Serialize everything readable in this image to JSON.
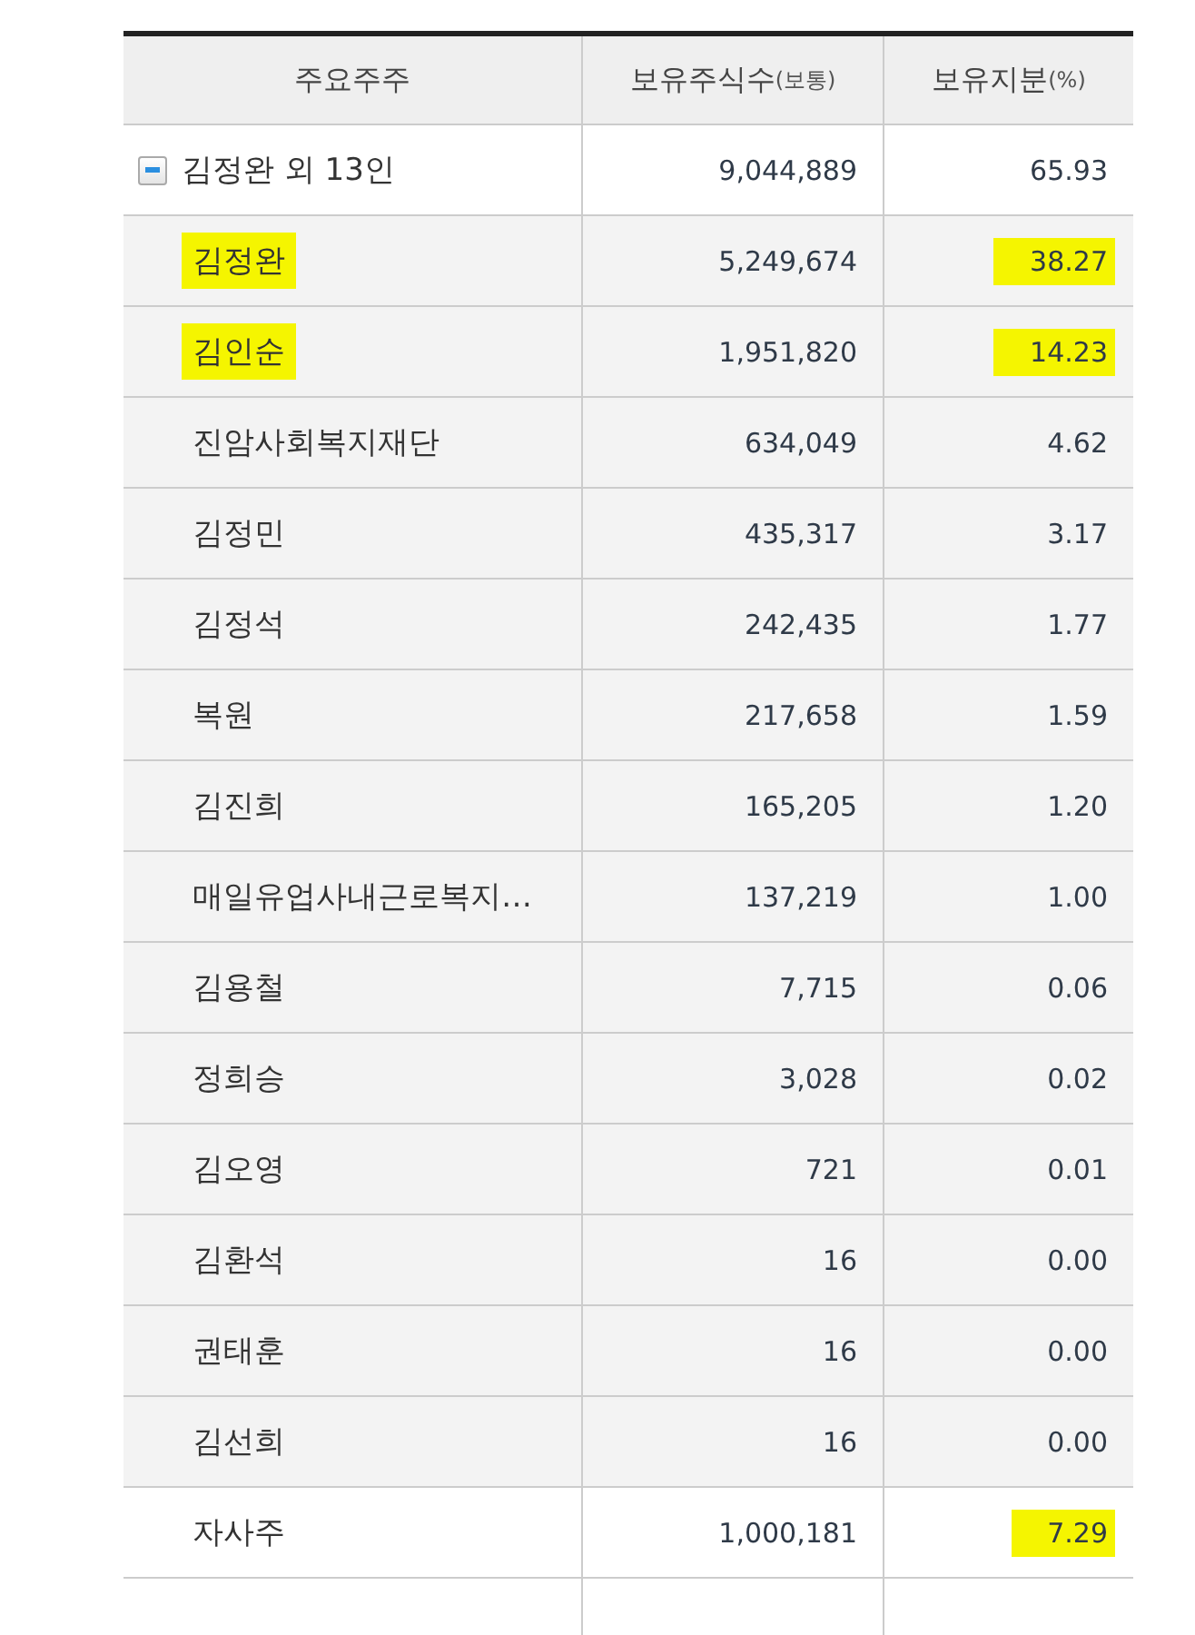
{
  "table": {
    "columns": [
      {
        "label": "주요주주"
      },
      {
        "label": "보유주식수",
        "unit": "(보통)"
      },
      {
        "label": "보유지분",
        "unit": "(%)"
      }
    ],
    "group": {
      "name": "김정완 외 13인",
      "shares": "9,044,889",
      "stake": "65.93",
      "expanded": true
    },
    "rows": [
      {
        "name": "김정완",
        "shares": "5,249,674",
        "stake": "38.27",
        "name_highlighted": true,
        "stake_highlighted": true
      },
      {
        "name": "김인순",
        "shares": "1,951,820",
        "stake": "14.23",
        "name_highlighted": true,
        "stake_highlighted": true
      },
      {
        "name": "진암사회복지재단",
        "shares": "634,049",
        "stake": "4.62",
        "name_highlighted": false,
        "stake_highlighted": false
      },
      {
        "name": "김정민",
        "shares": "435,317",
        "stake": "3.17",
        "name_highlighted": false,
        "stake_highlighted": false
      },
      {
        "name": "김정석",
        "shares": "242,435",
        "stake": "1.77",
        "name_highlighted": false,
        "stake_highlighted": false
      },
      {
        "name": "복원",
        "shares": "217,658",
        "stake": "1.59",
        "name_highlighted": false,
        "stake_highlighted": false
      },
      {
        "name": "김진희",
        "shares": "165,205",
        "stake": "1.20",
        "name_highlighted": false,
        "stake_highlighted": false
      },
      {
        "name": "매일유업사내근로복지…",
        "shares": "137,219",
        "stake": "1.00",
        "name_highlighted": false,
        "stake_highlighted": false
      },
      {
        "name": "김용철",
        "shares": "7,715",
        "stake": "0.06",
        "name_highlighted": false,
        "stake_highlighted": false
      },
      {
        "name": "정희승",
        "shares": "3,028",
        "stake": "0.02",
        "name_highlighted": false,
        "stake_highlighted": false
      },
      {
        "name": "김오영",
        "shares": "721",
        "stake": "0.01",
        "name_highlighted": false,
        "stake_highlighted": false
      },
      {
        "name": "김환석",
        "shares": "16",
        "stake": "0.00",
        "name_highlighted": false,
        "stake_highlighted": false
      },
      {
        "name": "권태훈",
        "shares": "16",
        "stake": "0.00",
        "name_highlighted": false,
        "stake_highlighted": false
      },
      {
        "name": "김선희",
        "shares": "16",
        "stake": "0.00",
        "name_highlighted": false,
        "stake_highlighted": false
      }
    ],
    "treasury": {
      "name": "자사주",
      "shares": "1,000,181",
      "stake": "7.29",
      "name_highlighted": false,
      "stake_highlighted": true
    }
  }
}
